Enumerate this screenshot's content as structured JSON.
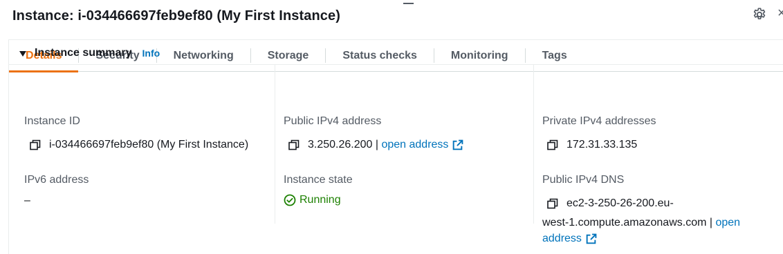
{
  "header": {
    "title": "Instance: i-034466697feb9ef80 (My First Instance)"
  },
  "tabs": [
    {
      "label": "Details",
      "active": true
    },
    {
      "label": "Security",
      "active": false
    },
    {
      "label": "Networking",
      "active": false
    },
    {
      "label": "Storage",
      "active": false
    },
    {
      "label": "Status checks",
      "active": false
    },
    {
      "label": "Monitoring",
      "active": false
    },
    {
      "label": "Tags",
      "active": false
    }
  ],
  "summary": {
    "title": "Instance summary",
    "info_label": "Info"
  },
  "fields": {
    "instance_id_label": "Instance ID",
    "instance_id_value": "i-034466697feb9ef80 (My First Instance)",
    "public_ipv4_label": "Public IPv4 address",
    "public_ipv4_value": "3.250.26.200",
    "public_ipv4_separator": " | ",
    "public_ipv4_link": "open address",
    "private_ipv4_label": "Private IPv4 addresses",
    "private_ipv4_value": "172.31.33.135",
    "ipv6_label": "IPv6 address",
    "ipv6_value": "–",
    "state_label": "Instance state",
    "state_value": "Running",
    "dns_label": "Public IPv4 DNS",
    "dns_value_line1": "ec2-3-250-26-200.eu-",
    "dns_value_line2": "west-1.compute.amazonaws.com",
    "dns_separator": " | ",
    "dns_link_part1": "open",
    "dns_link_part2": "address"
  },
  "icons": {
    "settings": "gear-icon",
    "copy": "copy-icon",
    "external": "external-link-icon",
    "status": "check-circle-icon"
  },
  "colors": {
    "active_tab": "#ec7211",
    "link": "#0073bb",
    "running": "#1d8102"
  }
}
